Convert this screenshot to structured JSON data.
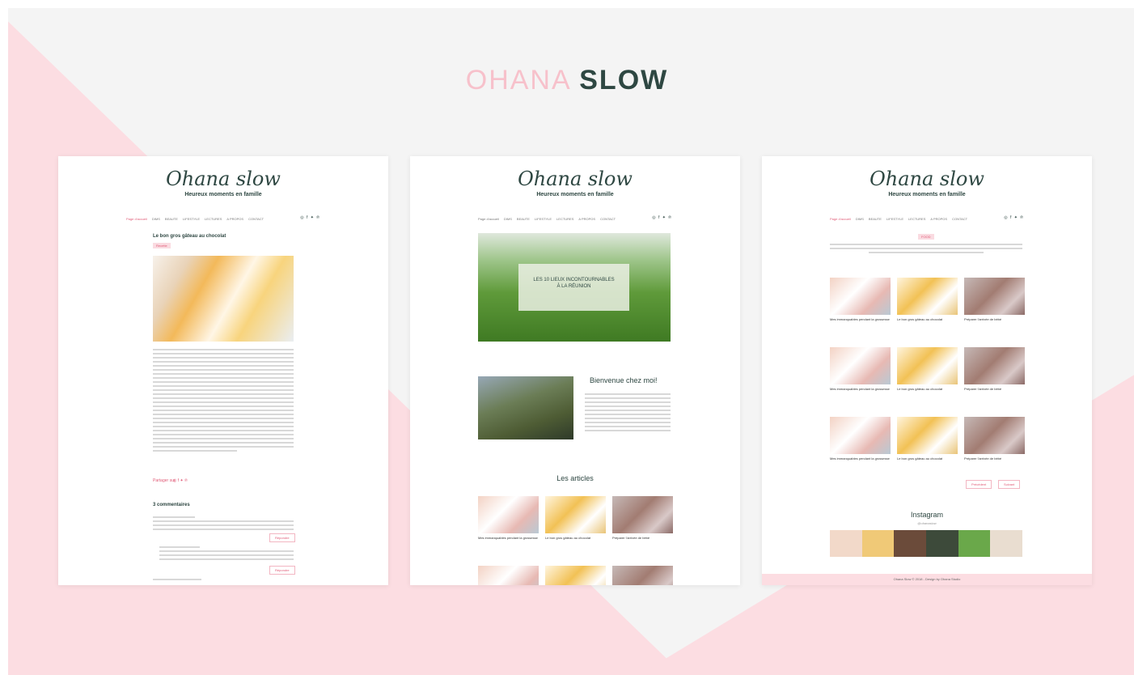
{
  "title": {
    "part1": "OHANA",
    "part2": "SLOW"
  },
  "blog": {
    "logo": "Ohana slow",
    "tagline": "Heureux moments en famille"
  },
  "nav": [
    "Page d'accueil",
    "DIMS",
    "BEAUTE",
    "LIFESTYLE",
    "LECTURES",
    "A PROPOS",
    "CONTACT"
  ],
  "social_glyphs": "◎ f ✦ ℗",
  "left_card": {
    "post_title": "Le bon gros gâteau au chocolat",
    "badge": "Recette",
    "share": "Partager sur",
    "comments_title": "3 commentaires",
    "reply": "Répondre"
  },
  "middle_card": {
    "hero_title_1": "LES 10 LIEUX INCONTOURNABLES",
    "hero_title_2": "À LA RÉUNION",
    "welcome": "Bienvenue chez moi!",
    "articles": "Les articles",
    "captions": [
      "Mes immanquables pendant la grossesse",
      "Le bon gros gâteau au chocolat",
      "Préparer l'arrivée de bébé"
    ]
  },
  "right_card": {
    "category": "FOOD",
    "captions": [
      "Mes immanquables pendant la grossesse",
      "Le bon gros gâteau au chocolat",
      "Préparer l'arrivée de bébé"
    ],
    "prev": "Précédent",
    "next": "Suivant",
    "instagram": "Instagram",
    "handle": "@ohanaslow",
    "footer": "Ohana Slow © 2018 - Design by Ohana Studio"
  },
  "colors": {
    "pink": "#fcdde2",
    "accent": "#e05b77",
    "dark": "#2e4742"
  }
}
